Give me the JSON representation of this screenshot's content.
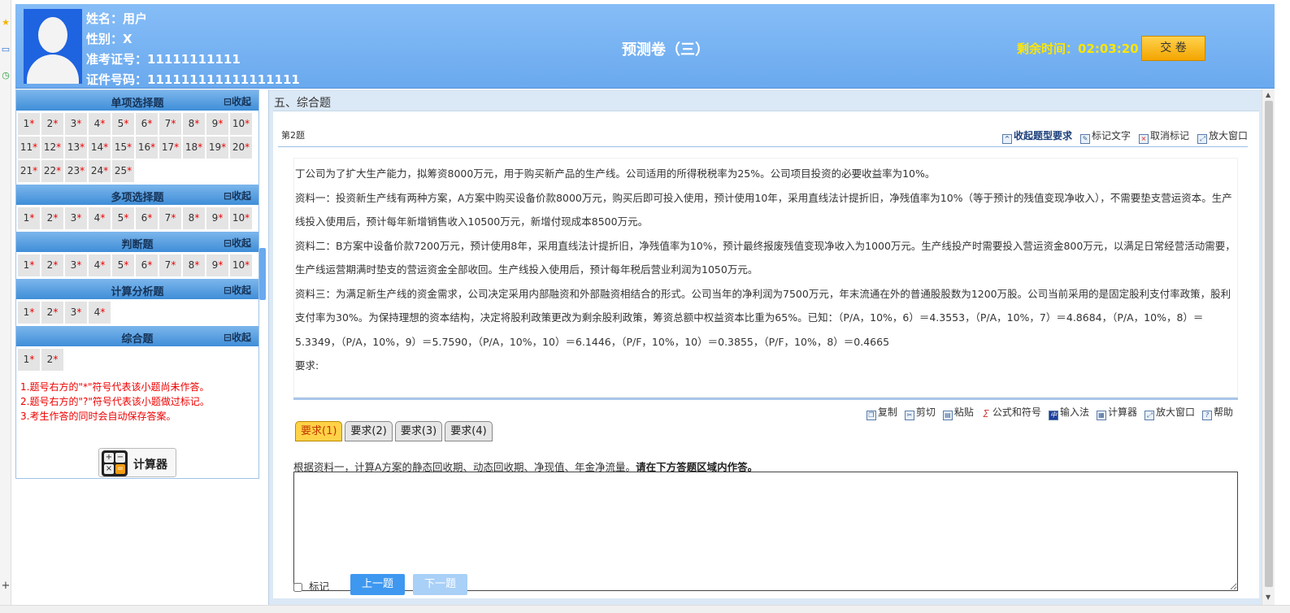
{
  "header": {
    "name_label": "姓名：用户",
    "gender_label": "性别：X",
    "ticket_label": "准考证号：11111111111",
    "id_label": "证件号码：111111111111111111",
    "exam_title": "预测卷（三）",
    "timer_label": "剩余时间：",
    "timer_value": "02:03:20",
    "submit_label": "交 卷"
  },
  "sidebar": {
    "collapse_label": "⊟收起",
    "sections": [
      {
        "title": "单项选择题",
        "items": [
          "1",
          "2",
          "3",
          "4",
          "5",
          "6",
          "7",
          "8",
          "9",
          "10",
          "11",
          "12",
          "13",
          "14",
          "15",
          "16",
          "17",
          "18",
          "19",
          "20",
          "21",
          "22",
          "23",
          "24",
          "25"
        ]
      },
      {
        "title": "多项选择题",
        "items": [
          "1",
          "2",
          "3",
          "4",
          "5",
          "6",
          "7",
          "8",
          "9",
          "10"
        ]
      },
      {
        "title": "判断题",
        "items": [
          "1",
          "2",
          "3",
          "4",
          "5",
          "6",
          "7",
          "8",
          "9",
          "10"
        ]
      },
      {
        "title": "计算分析题",
        "items": [
          "1",
          "2",
          "3",
          "4"
        ]
      },
      {
        "title": "综合题",
        "items": [
          "1",
          "2"
        ]
      }
    ],
    "unanswered_mark": "*",
    "notes": [
      "1.题号右方的\"*\"符号代表该小题尚未作答。",
      "2.题号右方的\"?\"符号代表该小题做过标记。",
      "3.考生作答的同时会自动保存答案。"
    ],
    "calculator_label": "计算器"
  },
  "main": {
    "section_title": "五、综合题",
    "question_number": "第2题",
    "top_tools": [
      "收起题型要求",
      "标记文字",
      "取消标记",
      "放大窗口"
    ],
    "stem": [
      "丁公司为了扩大生产能力，拟筹资8000万元，用于购买新产品的生产线。公司适用的所得税税率为25%。公司项目投资的必要收益率为10%。",
      "资料一：投资新生产线有两种方案，A方案中购买设备价款8000万元，购买后即可投入使用，预计使用10年，采用直线法计提折旧，净残值率为10%（等于预计的残值变现净收入），不需要垫支营运资本。生产线投入使用后，预计每年新增销售收入10500万元，新增付现成本8500万元。",
      "资料二：B方案中设备价款7200万元，预计使用8年，采用直线法计提折旧，净残值率为10%，预计最终报废残值变现净收入为1000万元。生产线投产时需要投入营运资金800万元，以满足日常经营活动需要，生产线运营期满时垫支的营运资金全部收回。生产线投入使用后，预计每年税后营业利润为1050万元。",
      "资料三：为满足新生产线的资金需求，公司决定采用内部融资和外部融资相结合的形式。公司当年的净利润为7500万元，年末流通在外的普通股股数为1200万股。公司当前采用的是固定股利支付率政策，股利支付率为30%。为保持理想的资本结构，决定将股利政策更改为剩余股利政策，筹资总额中权益资本比重为65%。已知：（P/A，10%，6）＝4.3553，（P/A，10%，7）＝4.8684，（P/A，10%，8）＝5.3349，（P/A，10%，9）＝5.7590，（P/A，10%，10）＝6.1446，（P/F，10%，10）＝0.3855，（P/F，10%，8）＝0.4665",
      "要求:"
    ],
    "edit_tools": [
      "复制",
      "剪切",
      "粘贴",
      "公式和符号",
      "输入法",
      "计算器",
      "放大窗口",
      "帮助"
    ],
    "tabs": [
      "要求(1)",
      "要求(2)",
      "要求(3)",
      "要求(4)"
    ],
    "requirement_text": "根据资料一，计算A方案的静态回收期、动态回收期、净现值、年金净流量。",
    "requirement_bold": "请在下方答题区域内作答。",
    "mark_label": "标记",
    "prev_label": "上一题",
    "next_label": "下一题"
  }
}
